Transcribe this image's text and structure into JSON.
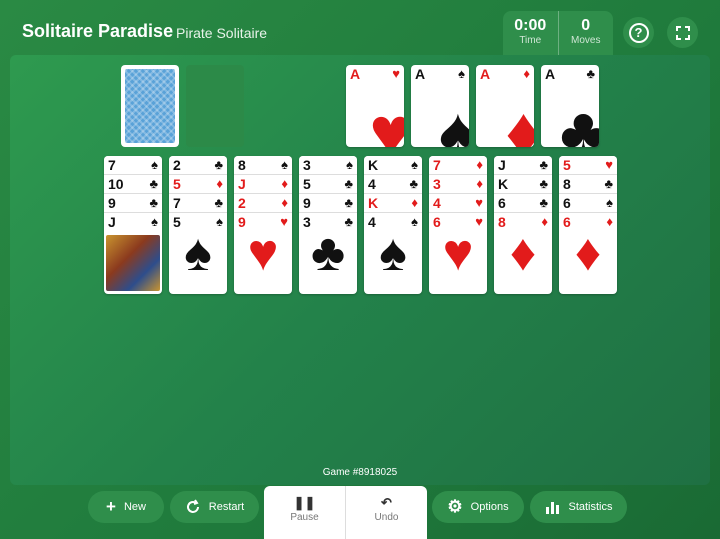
{
  "header": {
    "app_title": "Solitaire Paradise",
    "game_name": "Pirate Solitaire",
    "time_value": "0:00",
    "time_label": "Time",
    "moves_value": "0",
    "moves_label": "Moves",
    "help_icon": "question-circle-icon",
    "fullscreen_icon": "fullscreen-icon"
  },
  "foundations": [
    {
      "rank": "A",
      "suit": "♥",
      "color": "red"
    },
    {
      "rank": "A",
      "suit": "♠",
      "color": "blk"
    },
    {
      "rank": "A",
      "suit": "♦",
      "color": "red"
    },
    {
      "rank": "A",
      "suit": "♣",
      "color": "blk"
    }
  ],
  "tableau": [
    {
      "cards": [
        {
          "rank": "7",
          "suit": "♠"
        },
        {
          "rank": "10",
          "suit": "♣"
        },
        {
          "rank": "9",
          "suit": "♣"
        },
        {
          "rank": "J",
          "suit": "♠"
        }
      ],
      "face": "jack"
    },
    {
      "cards": [
        {
          "rank": "2",
          "suit": "♣"
        },
        {
          "rank": "5",
          "suit": "♦"
        },
        {
          "rank": "7",
          "suit": "♣"
        },
        {
          "rank": "5",
          "suit": "♠"
        }
      ]
    },
    {
      "cards": [
        {
          "rank": "8",
          "suit": "♠"
        },
        {
          "rank": "J",
          "suit": "♦"
        },
        {
          "rank": "2",
          "suit": "♦"
        },
        {
          "rank": "9",
          "suit": "♥"
        }
      ]
    },
    {
      "cards": [
        {
          "rank": "3",
          "suit": "♠"
        },
        {
          "rank": "5",
          "suit": "♣"
        },
        {
          "rank": "9",
          "suit": "♣"
        },
        {
          "rank": "3",
          "suit": "♣"
        }
      ]
    },
    {
      "cards": [
        {
          "rank": "K",
          "suit": "♠"
        },
        {
          "rank": "4",
          "suit": "♣"
        },
        {
          "rank": "K",
          "suit": "♦"
        },
        {
          "rank": "4",
          "suit": "♠"
        }
      ]
    },
    {
      "cards": [
        {
          "rank": "7",
          "suit": "♦"
        },
        {
          "rank": "3",
          "suit": "♦"
        },
        {
          "rank": "4",
          "suit": "♥"
        },
        {
          "rank": "6",
          "suit": "♥"
        }
      ]
    },
    {
      "cards": [
        {
          "rank": "J",
          "suit": "♣"
        },
        {
          "rank": "K",
          "suit": "♣"
        },
        {
          "rank": "6",
          "suit": "♣"
        },
        {
          "rank": "8",
          "suit": "♦"
        }
      ]
    },
    {
      "cards": [
        {
          "rank": "5",
          "suit": "♥"
        },
        {
          "rank": "8",
          "suit": "♣"
        },
        {
          "rank": "6",
          "suit": "♠"
        },
        {
          "rank": "6",
          "suit": "♦"
        }
      ]
    }
  ],
  "game_number": "Game #8918025",
  "toolbar": {
    "new_label": "New",
    "restart_label": "Restart",
    "pause_label": "Pause",
    "undo_label": "Undo",
    "options_label": "Options",
    "statistics_label": "Statistics"
  }
}
